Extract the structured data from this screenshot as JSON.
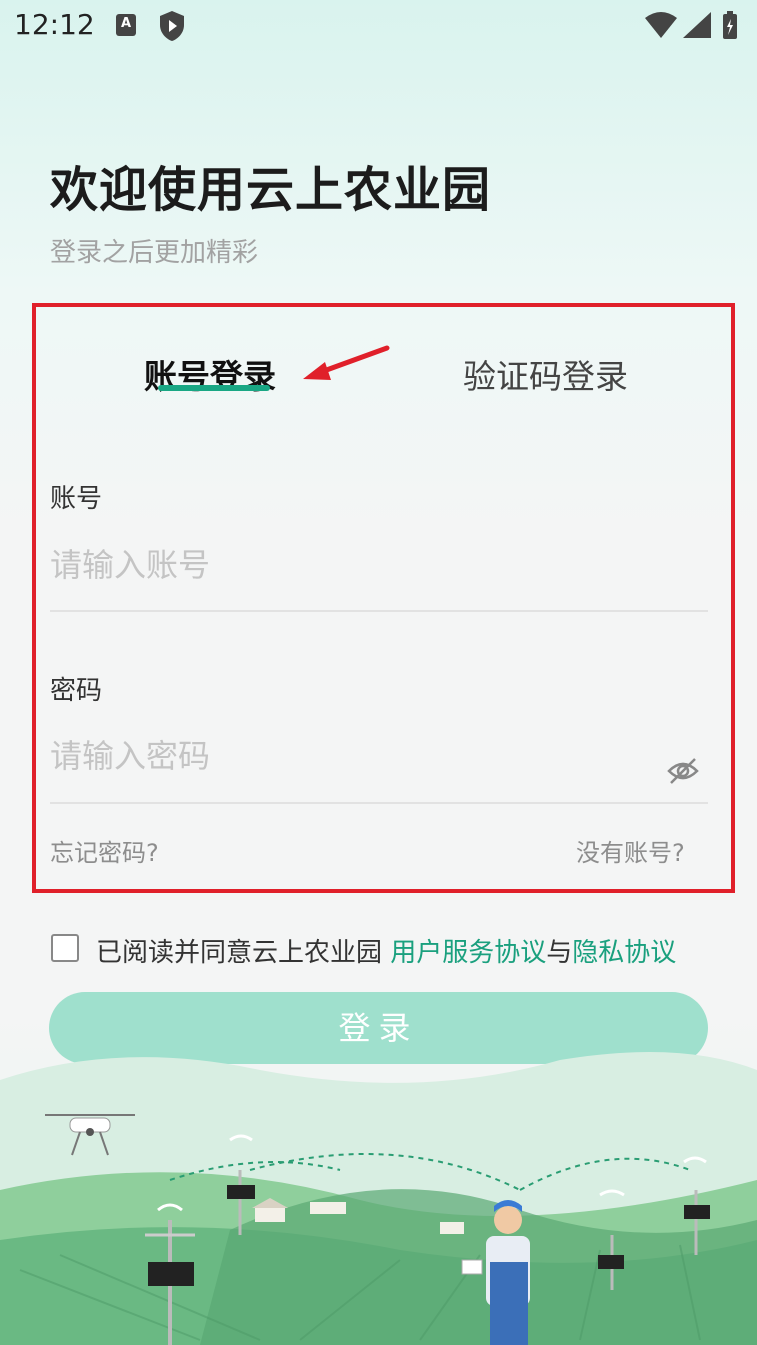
{
  "status_bar": {
    "time": "12:12",
    "a_icon_letter": "A",
    "icons": [
      "a-notification-icon",
      "shield-play-icon",
      "wifi-icon",
      "signal-icon",
      "battery-icon"
    ]
  },
  "header": {
    "title": "欢迎使用云上农业园",
    "subtitle": "登录之后更加精彩"
  },
  "tabs": {
    "account_login": "账号登录",
    "code_login": "验证码登录"
  },
  "form": {
    "account_label": "账号",
    "account_placeholder": "请输入账号",
    "password_label": "密码",
    "password_placeholder": "请输入密码",
    "forgot_password": "忘记密码?",
    "no_account": "没有账号?"
  },
  "agreement": {
    "text": "已阅读并同意云上农业园 ",
    "terms_link": "用户服务协议",
    "joiner": "与",
    "privacy_link": "隐私协议"
  },
  "login_button": "登录",
  "colors": {
    "accent": "#19a784",
    "button": "#9fe0cd",
    "highlight_border": "#e0202a"
  }
}
